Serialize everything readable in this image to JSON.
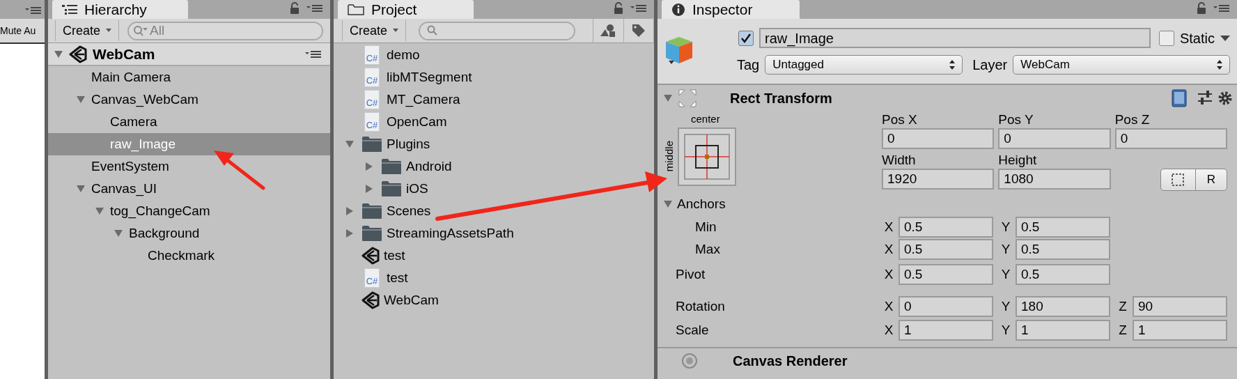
{
  "left_panel": {
    "toolbar_text": "Mute Au"
  },
  "hierarchy": {
    "title": "Hierarchy",
    "create": "Create",
    "search_placeholder": "All",
    "scene": {
      "name": "WebCam",
      "expanded": true
    },
    "items": [
      {
        "name": "Main Camera",
        "selected": false
      },
      {
        "name": "Canvas_WebCam",
        "selected": false,
        "expanded": true,
        "children": [
          {
            "name": "Camera",
            "selected": false
          },
          {
            "name": "raw_Image",
            "selected": true
          }
        ]
      },
      {
        "name": "EventSystem",
        "selected": false
      },
      {
        "name": "Canvas_UI",
        "selected": false,
        "expanded": true,
        "children": [
          {
            "name": "tog_ChangeCam",
            "selected": false,
            "expanded": true,
            "children": [
              {
                "name": "Background",
                "selected": false,
                "expanded": true,
                "children": [
                  {
                    "name": "Checkmark",
                    "selected": false
                  }
                ]
              }
            ]
          }
        ]
      }
    ]
  },
  "project": {
    "title": "Project",
    "create": "Create",
    "items": [
      {
        "kind": "script",
        "name": "demo",
        "icon_label": "C#"
      },
      {
        "kind": "script",
        "name": "libMTSegment",
        "icon_label": "C#"
      },
      {
        "kind": "script",
        "name": "MT_Camera",
        "icon_label": "C#"
      },
      {
        "kind": "script",
        "name": "OpenCam",
        "icon_label": "C#"
      },
      {
        "kind": "folder",
        "name": "Plugins",
        "expanded": true,
        "children": [
          {
            "kind": "folder",
            "name": "Android",
            "expanded": false
          },
          {
            "kind": "folder",
            "name": "iOS",
            "expanded": false
          }
        ]
      },
      {
        "kind": "folder",
        "name": "Scenes",
        "expanded": false
      },
      {
        "kind": "folder",
        "name": "StreamingAssetsPath",
        "expanded": false
      },
      {
        "kind": "scene",
        "name": "test"
      },
      {
        "kind": "script",
        "name": "test",
        "icon_label": "C#"
      },
      {
        "kind": "scene",
        "name": "WebCam"
      }
    ]
  },
  "inspector": {
    "title": "Inspector",
    "active": true,
    "object_name": "raw_Image",
    "static": {
      "label": "Static",
      "checked": false
    },
    "tag": {
      "label": "Tag",
      "value": "Untagged"
    },
    "layer": {
      "label": "Layer",
      "value": "WebCam"
    },
    "rect_transform": {
      "title": "Rect Transform",
      "expanded": true,
      "anchor_preset": {
        "top": "center",
        "side": "middle"
      },
      "pos_labels": [
        "Pos X",
        "Pos Y",
        "Pos Z"
      ],
      "pos_values": [
        "0",
        "0",
        "0"
      ],
      "size_labels": [
        "Width",
        "Height"
      ],
      "size_values": [
        "1920",
        "1080"
      ],
      "raw_button": "R",
      "anchors": {
        "label": "Anchors",
        "expanded": true,
        "rows": [
          {
            "label": "Min",
            "fields": [
              {
                "axis": "X",
                "value": "0.5"
              },
              {
                "axis": "Y",
                "value": "0.5"
              }
            ]
          },
          {
            "label": "Max",
            "fields": [
              {
                "axis": "X",
                "value": "0.5"
              },
              {
                "axis": "Y",
                "value": "0.5"
              }
            ]
          }
        ]
      },
      "rows": [
        {
          "label": "Pivot",
          "fields": [
            {
              "axis": "X",
              "value": "0.5"
            },
            {
              "axis": "Y",
              "value": "0.5"
            }
          ]
        },
        {
          "label": "Rotation",
          "fields": [
            {
              "axis": "X",
              "value": "0"
            },
            {
              "axis": "Y",
              "value": "180"
            },
            {
              "axis": "Z",
              "value": "90"
            }
          ]
        },
        {
          "label": "Scale",
          "fields": [
            {
              "axis": "X",
              "value": "1"
            },
            {
              "axis": "Y",
              "value": "1"
            },
            {
              "axis": "Z",
              "value": "1"
            }
          ]
        }
      ]
    },
    "next_component": "Canvas Renderer"
  }
}
